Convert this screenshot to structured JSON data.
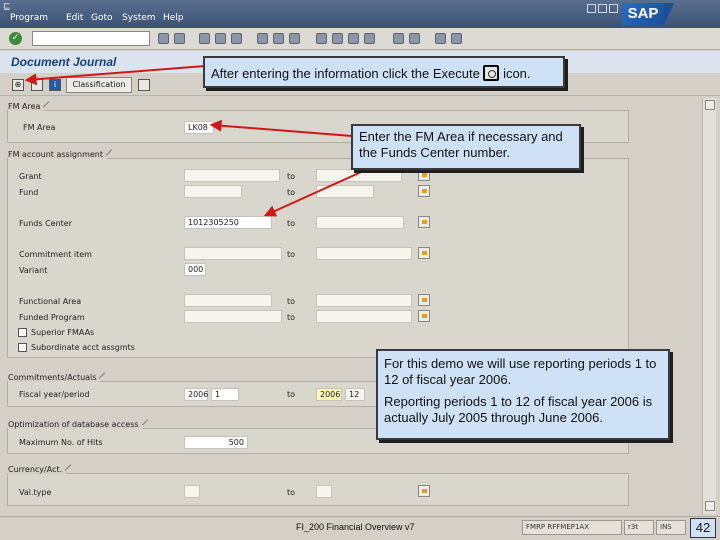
{
  "menubar": {
    "app_glyph": "⊑",
    "items": [
      "Program",
      "Edit",
      "Goto",
      "System",
      "Help"
    ],
    "logo": "SAP"
  },
  "title": "Document Journal",
  "toolbar": {
    "classification_label": "Classification"
  },
  "groups": {
    "fm_area": {
      "title": "FM Area",
      "fm_area_label": "FM Area",
      "fm_area_value": "LK08"
    },
    "account_assignment": {
      "title": "FM account assignment",
      "grant_label": "Grant",
      "fund_label": "Fund",
      "to_label": "to",
      "funds_center_label": "Funds Center",
      "funds_center_value": "1012305250",
      "commitment_item_label": "Commitment item",
      "variant_label": "Variant",
      "variant_value": "000",
      "functional_area_label": "Functional Area",
      "funded_program_label": "Funded Program",
      "superior_fmaas_label": "Superior FMAAs",
      "subordinate_label": "Subordinate acct assgmts"
    },
    "commitments": {
      "title": "Commitments/Actuals",
      "fiscal_period_label": "Fiscal year/period",
      "from_year": "2006",
      "from_period": "1",
      "to_year": "2006",
      "to_period": "12"
    },
    "optimization": {
      "title": "Optimization of database access",
      "max_hits_label": "Maximum No. of Hits",
      "max_hits_value": "500"
    },
    "currency": {
      "title": "Currency/Act.",
      "value_type_label": "Val.type"
    }
  },
  "callouts": {
    "execute": {
      "before": "After entering the information click the Execute",
      "after": "icon."
    },
    "fm_area": "Enter the FM Area if necessary and the Funds Center number.",
    "periods_1": "For this demo we will use reporting periods 1 to 12 of fiscal year 2006.",
    "periods_2": "Reporting periods 1 to 12 of fiscal year 2006 is actually July 2005 through June 2006."
  },
  "status": {
    "footer": "FI_200 Financial Overview v7",
    "system": "FMRP RFFMEP1AX",
    "server": "r3t",
    "mode": "INS",
    "page": "42"
  },
  "colors": {
    "callout_bg": "#cfe1f7",
    "arrow": "#d01818",
    "title": "#1c3f7a"
  }
}
